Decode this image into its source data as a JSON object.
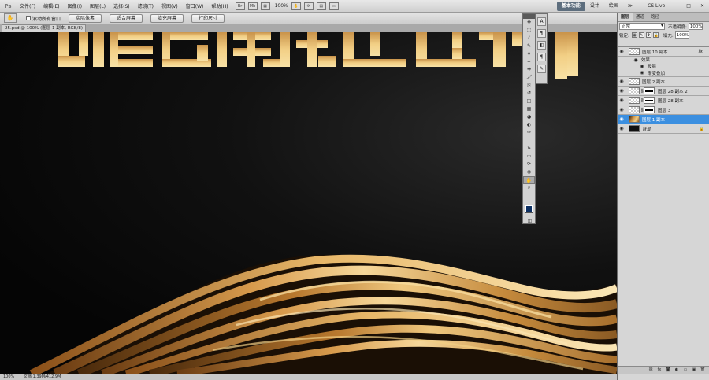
{
  "app_logo": "Ps",
  "menus": [
    "文件(F)",
    "编辑(E)",
    "图像(I)",
    "图层(L)",
    "选择(S)",
    "滤镜(T)",
    "视图(V)",
    "窗口(W)",
    "帮助(H)"
  ],
  "menubar": {
    "zoom": "100%",
    "more": "≫"
  },
  "workspaces": {
    "basic": "基本功能",
    "design": "设计",
    "paint": "绘画",
    "more": "≫",
    "cs_live": "CS Live"
  },
  "options": {
    "scroll_all": "滚动所有窗口",
    "actual_pixels": "实际像素",
    "fit_screen": "适合屏幕",
    "fill_screen": "填充屏幕",
    "print_size": "打印尺寸"
  },
  "document": {
    "tab": "25.psd @ 100% (图层 1 副本, RGB/8)"
  },
  "status": {
    "zoom": "100%",
    "doc": "文档:1.39M/412.9M"
  },
  "colors": {
    "foreground": "#0c2f63",
    "background": "#ffffff",
    "selection": "#3b8fe0"
  },
  "panel": {
    "tabs": [
      "图层",
      "通道",
      "路径"
    ],
    "blend_mode": "正常",
    "opacity_label": "不透明度:",
    "opacity": "100%",
    "lock_label": "锁定:",
    "fill_label": "填充:",
    "fill": "100%"
  },
  "layers": [
    {
      "name": "图层 10 副本",
      "thumb": "checker",
      "fx": "fx"
    },
    {
      "name": "效果",
      "sub": true
    },
    {
      "name": "投影",
      "sub": true
    },
    {
      "name": "渐变叠加",
      "sub": true
    },
    {
      "name": "图层 2 副本",
      "thumb": "checker"
    },
    {
      "name": "图层 28 副本 2",
      "thumb": "checker",
      "mask": true
    },
    {
      "name": "图层 28 副本",
      "thumb": "checker",
      "mask": true
    },
    {
      "name": "图层 3",
      "thumb": "checker",
      "mask": true
    },
    {
      "name": "图层 1 副本",
      "thumb": "photo",
      "selected": true
    },
    {
      "name": "背景",
      "thumb": "black",
      "locked": true
    }
  ],
  "tools": [
    "move-tool",
    "marquee-tool",
    "lasso-tool",
    "quick-select-tool",
    "crop-tool",
    "eyedropper-tool",
    "healing-tool",
    "brush-tool",
    "clone-stamp-tool",
    "history-brush-tool",
    "eraser-tool",
    "gradient-tool",
    "blur-tool",
    "dodge-tool",
    "pen-tool",
    "type-tool",
    "path-select-tool",
    "shape-tool",
    "3d-rotate-tool",
    "3d-camera-tool",
    "hand-tool",
    "zoom-tool"
  ],
  "tool_glyphs": [
    "✥",
    "⬚",
    "ℓ",
    "✎",
    "⌗",
    "✒",
    "✚",
    "🖌",
    "⎘",
    "↺",
    "◫",
    "▦",
    "◕",
    "◐",
    "✑",
    "T",
    "➤",
    "▭",
    "⟳",
    "◉",
    "✋",
    "⌕"
  ]
}
